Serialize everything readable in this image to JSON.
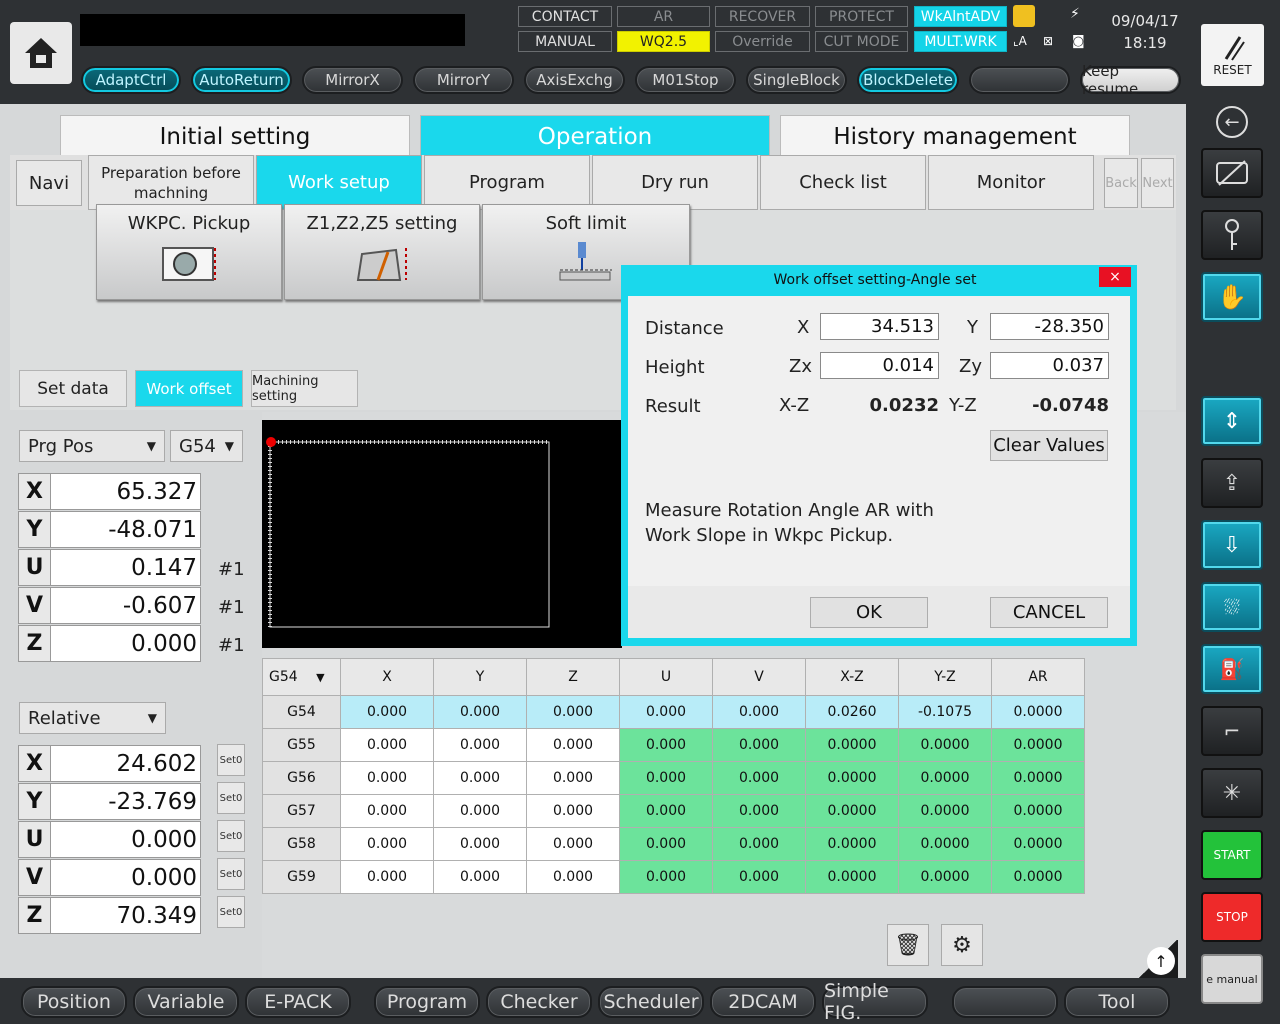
{
  "status": {
    "row1": [
      "CONTACT",
      "AR",
      "RECOVER",
      "PROTECT",
      "WkAlntADV"
    ],
    "row2": [
      "MANUAL",
      "WQ2.5",
      "Override",
      "CUT MODE",
      "MULT.WRK"
    ],
    "date": "09/04/17",
    "time": "18:19",
    "reset": "RESET"
  },
  "toolbar": [
    "AdaptCtrl",
    "AutoReturn",
    "MirrorX",
    "MirrorY",
    "AxisExchg",
    "M01Stop",
    "SingleBlock",
    "BlockDelete",
    "",
    "Keep resume"
  ],
  "main_tabs": [
    "Initial setting",
    "Operation",
    "History management"
  ],
  "sub_tabs": [
    "Navi",
    "Preparation before machning",
    "Work setup",
    "Program",
    "Dry run",
    "Check list",
    "Monitor",
    "Back",
    "Next"
  ],
  "tools": [
    "WKPC. Pickup",
    "Z1,Z2,Z5 setting",
    "Soft limit"
  ],
  "mode_buttons": [
    "Set data",
    "Work offset",
    "Machining setting"
  ],
  "prg_pos": {
    "selector": "Prg Pos",
    "coord": "G54",
    "axes": [
      {
        "label": "X",
        "value": "65.327",
        "suffix": ""
      },
      {
        "label": "Y",
        "value": "-48.071",
        "suffix": ""
      },
      {
        "label": "U",
        "value": "0.147",
        "suffix": "#1"
      },
      {
        "label": "V",
        "value": "-0.607",
        "suffix": "#1"
      },
      {
        "label": "Z",
        "value": "0.000",
        "suffix": "#1"
      }
    ]
  },
  "relative": {
    "selector": "Relative",
    "set0": "Set0",
    "axes": [
      {
        "label": "X",
        "value": "24.602"
      },
      {
        "label": "Y",
        "value": "-23.769"
      },
      {
        "label": "U",
        "value": "0.000"
      },
      {
        "label": "V",
        "value": "0.000"
      },
      {
        "label": "Z",
        "value": "70.349"
      }
    ]
  },
  "table": {
    "selector": "G54",
    "headers": [
      "X",
      "Y",
      "Z",
      "U",
      "V",
      "X-Z",
      "Y-Z",
      "AR"
    ],
    "rows": [
      {
        "name": "G54",
        "values": [
          "0.000",
          "0.000",
          "0.000",
          "0.000",
          "0.000",
          "0.0260",
          "-0.1075",
          "0.0000"
        ]
      },
      {
        "name": "G55",
        "values": [
          "0.000",
          "0.000",
          "0.000",
          "0.000",
          "0.000",
          "0.0000",
          "0.0000",
          "0.0000"
        ]
      },
      {
        "name": "G56",
        "values": [
          "0.000",
          "0.000",
          "0.000",
          "0.000",
          "0.000",
          "0.0000",
          "0.0000",
          "0.0000"
        ]
      },
      {
        "name": "G57",
        "values": [
          "0.000",
          "0.000",
          "0.000",
          "0.000",
          "0.000",
          "0.0000",
          "0.0000",
          "0.0000"
        ]
      },
      {
        "name": "G58",
        "values": [
          "0.000",
          "0.000",
          "0.000",
          "0.000",
          "0.000",
          "0.0000",
          "0.0000",
          "0.0000"
        ]
      },
      {
        "name": "G59",
        "values": [
          "0.000",
          "0.000",
          "0.000",
          "0.000",
          "0.000",
          "0.0000",
          "0.0000",
          "0.0000"
        ]
      }
    ]
  },
  "dialog": {
    "title": "Work offset setting-Angle set",
    "close": "×",
    "distance_label": "Distance",
    "x_label": "X",
    "x_value": "34.513",
    "y_label": "Y",
    "y_value": "-28.350",
    "height_label": "Height",
    "zx_label": "Zx",
    "zx_value": "0.014",
    "zy_label": "Zy",
    "zy_value": "0.037",
    "result_label": "Result",
    "xz_label": "X-Z",
    "xz_value": "0.0232",
    "yz_label": "Y-Z",
    "yz_value": "-0.0748",
    "clear": "Clear Values",
    "message_line1": "Measure Rotation Angle AR with",
    "message_line2": "Work Slope in Wkpc Pickup.",
    "ok": "OK",
    "cancel": "CANCEL"
  },
  "right_buttons": {
    "start": "START",
    "stop": "STOP",
    "manual": "e manual"
  },
  "bottom": [
    "Position",
    "Variable",
    "E-PACK",
    "Program",
    "Checker",
    "Scheduler",
    "2DCAM",
    "Simple FIG.",
    "",
    "Tool"
  ]
}
